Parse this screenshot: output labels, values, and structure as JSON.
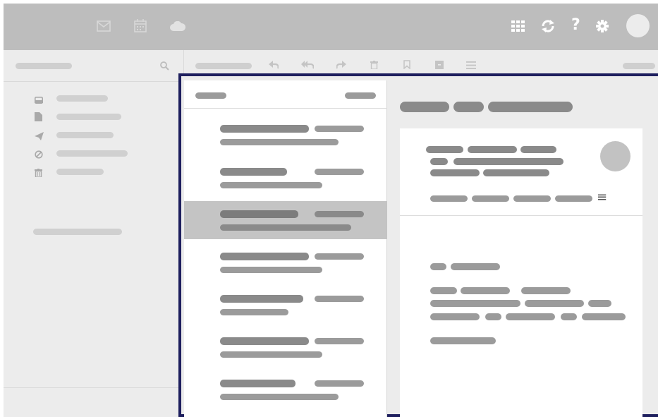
{
  "topbar": {
    "app_icons": [
      {
        "name": "mail-icon",
        "active": false
      },
      {
        "name": "calendar-icon",
        "active": false
      },
      {
        "name": "cloud-icon",
        "active": false
      }
    ],
    "right_icons": [
      {
        "name": "apps-grid-icon"
      },
      {
        "name": "refresh-icon"
      },
      {
        "name": "help-icon"
      },
      {
        "name": "settings-gear-icon"
      }
    ],
    "help_glyph": "?"
  },
  "sidebar": {
    "search_icon": "search-icon",
    "folders": [
      {
        "icon": "inbox-icon"
      },
      {
        "icon": "drafts-icon"
      },
      {
        "icon": "sent-icon"
      },
      {
        "icon": "spam-icon"
      },
      {
        "icon": "trash-icon"
      }
    ]
  },
  "toolbar": {
    "tools": [
      "reply-icon",
      "reply-all-icon",
      "forward-icon",
      "delete-icon",
      "bookmark-icon",
      "archive-icon",
      "more-menu-icon"
    ]
  },
  "message_list": {
    "selected_index": 2,
    "count": 7
  },
  "reading_pane": {
    "header_menu_icon": "menu-icon",
    "menu_glyph": "≡"
  },
  "colors": {
    "topbar": "#bdbdbd",
    "sidebar": "#ececec",
    "panel_border": "#1e1f5e",
    "selected_row": "#c4c4c4"
  }
}
